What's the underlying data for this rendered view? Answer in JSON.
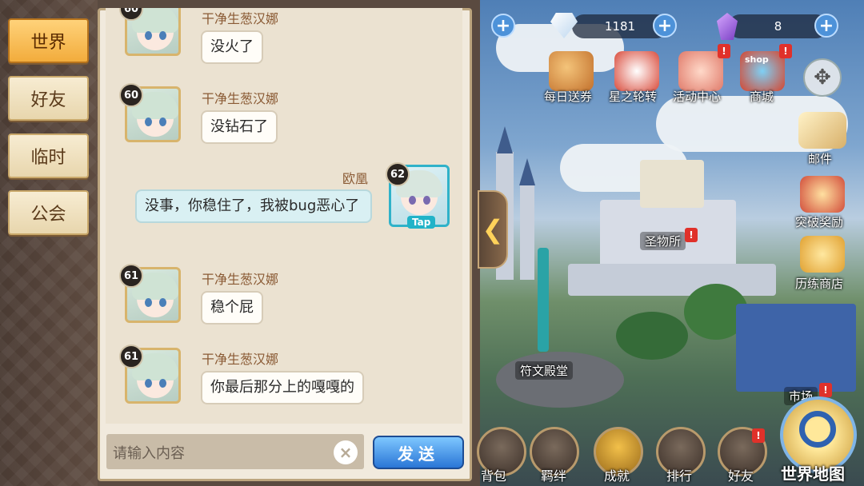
{
  "tabs": [
    "世界",
    "好友",
    "临时",
    "公会"
  ],
  "active_tab": "世界",
  "messages": [
    {
      "level": "60",
      "name": "干净生葱汉娜",
      "text": "没火了"
    },
    {
      "level": "60",
      "name": "干净生葱汉娜",
      "text": "没钻石了"
    },
    {
      "level": "62",
      "name": "欧凰",
      "text": "没事，你稳住了，我被bug恶心了",
      "mine": true,
      "tap": "Tap"
    },
    {
      "level": "61",
      "name": "干净生葱汉娜",
      "text": "稳个屁"
    },
    {
      "level": "61",
      "name": "干净生葱汉娜",
      "text": "你最后那分上的嘎嘎的"
    }
  ],
  "input": {
    "placeholder": "请输入内容"
  },
  "send_label": "发送",
  "clear_label": "×",
  "collapse_label": "❮",
  "currency": {
    "diamonds": "1181",
    "crystals": "8"
  },
  "top_menu": [
    "每日送券",
    "星之轮转",
    "活动中心",
    "商城"
  ],
  "shop_sign": "shop",
  "right_menu": [
    "邮件",
    "突破奖励",
    "历练商店"
  ],
  "places": [
    "圣物所",
    "符文殿堂",
    "市场"
  ],
  "bottom_menu": [
    "背包",
    "羁绊",
    "成就",
    "排行",
    "好友"
  ],
  "world_map_label": "世界地图",
  "colors": {
    "accent_gold": "#f2ac3c",
    "send_blue": "#2a76d6",
    "badge_red": "#e0312a"
  }
}
